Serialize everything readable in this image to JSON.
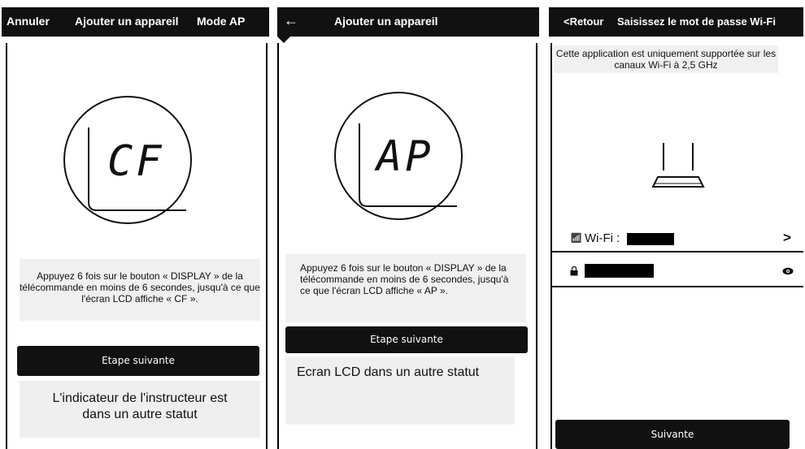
{
  "screen1": {
    "header": {
      "cancel": "Annuler",
      "title": "Ajouter un appareil",
      "mode": "Mode AP"
    },
    "lcd_text": "CF",
    "instruction": "Appuyez 6 fois sur le bouton « DISPLAY » de la télécommande en moins de 6 secondes, jusqu'à ce que l'écran LCD affiche « CF ».",
    "next_button": "Etape suivante",
    "alt_status": "L'indicateur de l'instructeur est dans un autre statut"
  },
  "screen2": {
    "header": {
      "back_icon": "←",
      "title": "Ajouter un appareil"
    },
    "lcd_text": "AP",
    "instruction": "Appuyez 6 fois sur le bouton « DISPLAY » de la télécommande en moins de 6 secondes, jusqu'à ce que l'écran LCD affiche « AP ».",
    "next_button": "Etape suivante",
    "alt_status": "Ecran LCD dans un autre statut"
  },
  "screen3": {
    "header": {
      "back": "<Retour",
      "title": "Saisissez le mot de passe Wi-Fi"
    },
    "notice": "Cette application est uniquement supportée sur les canaux Wi-Fi à 2,5 GHz",
    "wifi_label": "Wi-Fi :",
    "next_button": "Suivante"
  }
}
